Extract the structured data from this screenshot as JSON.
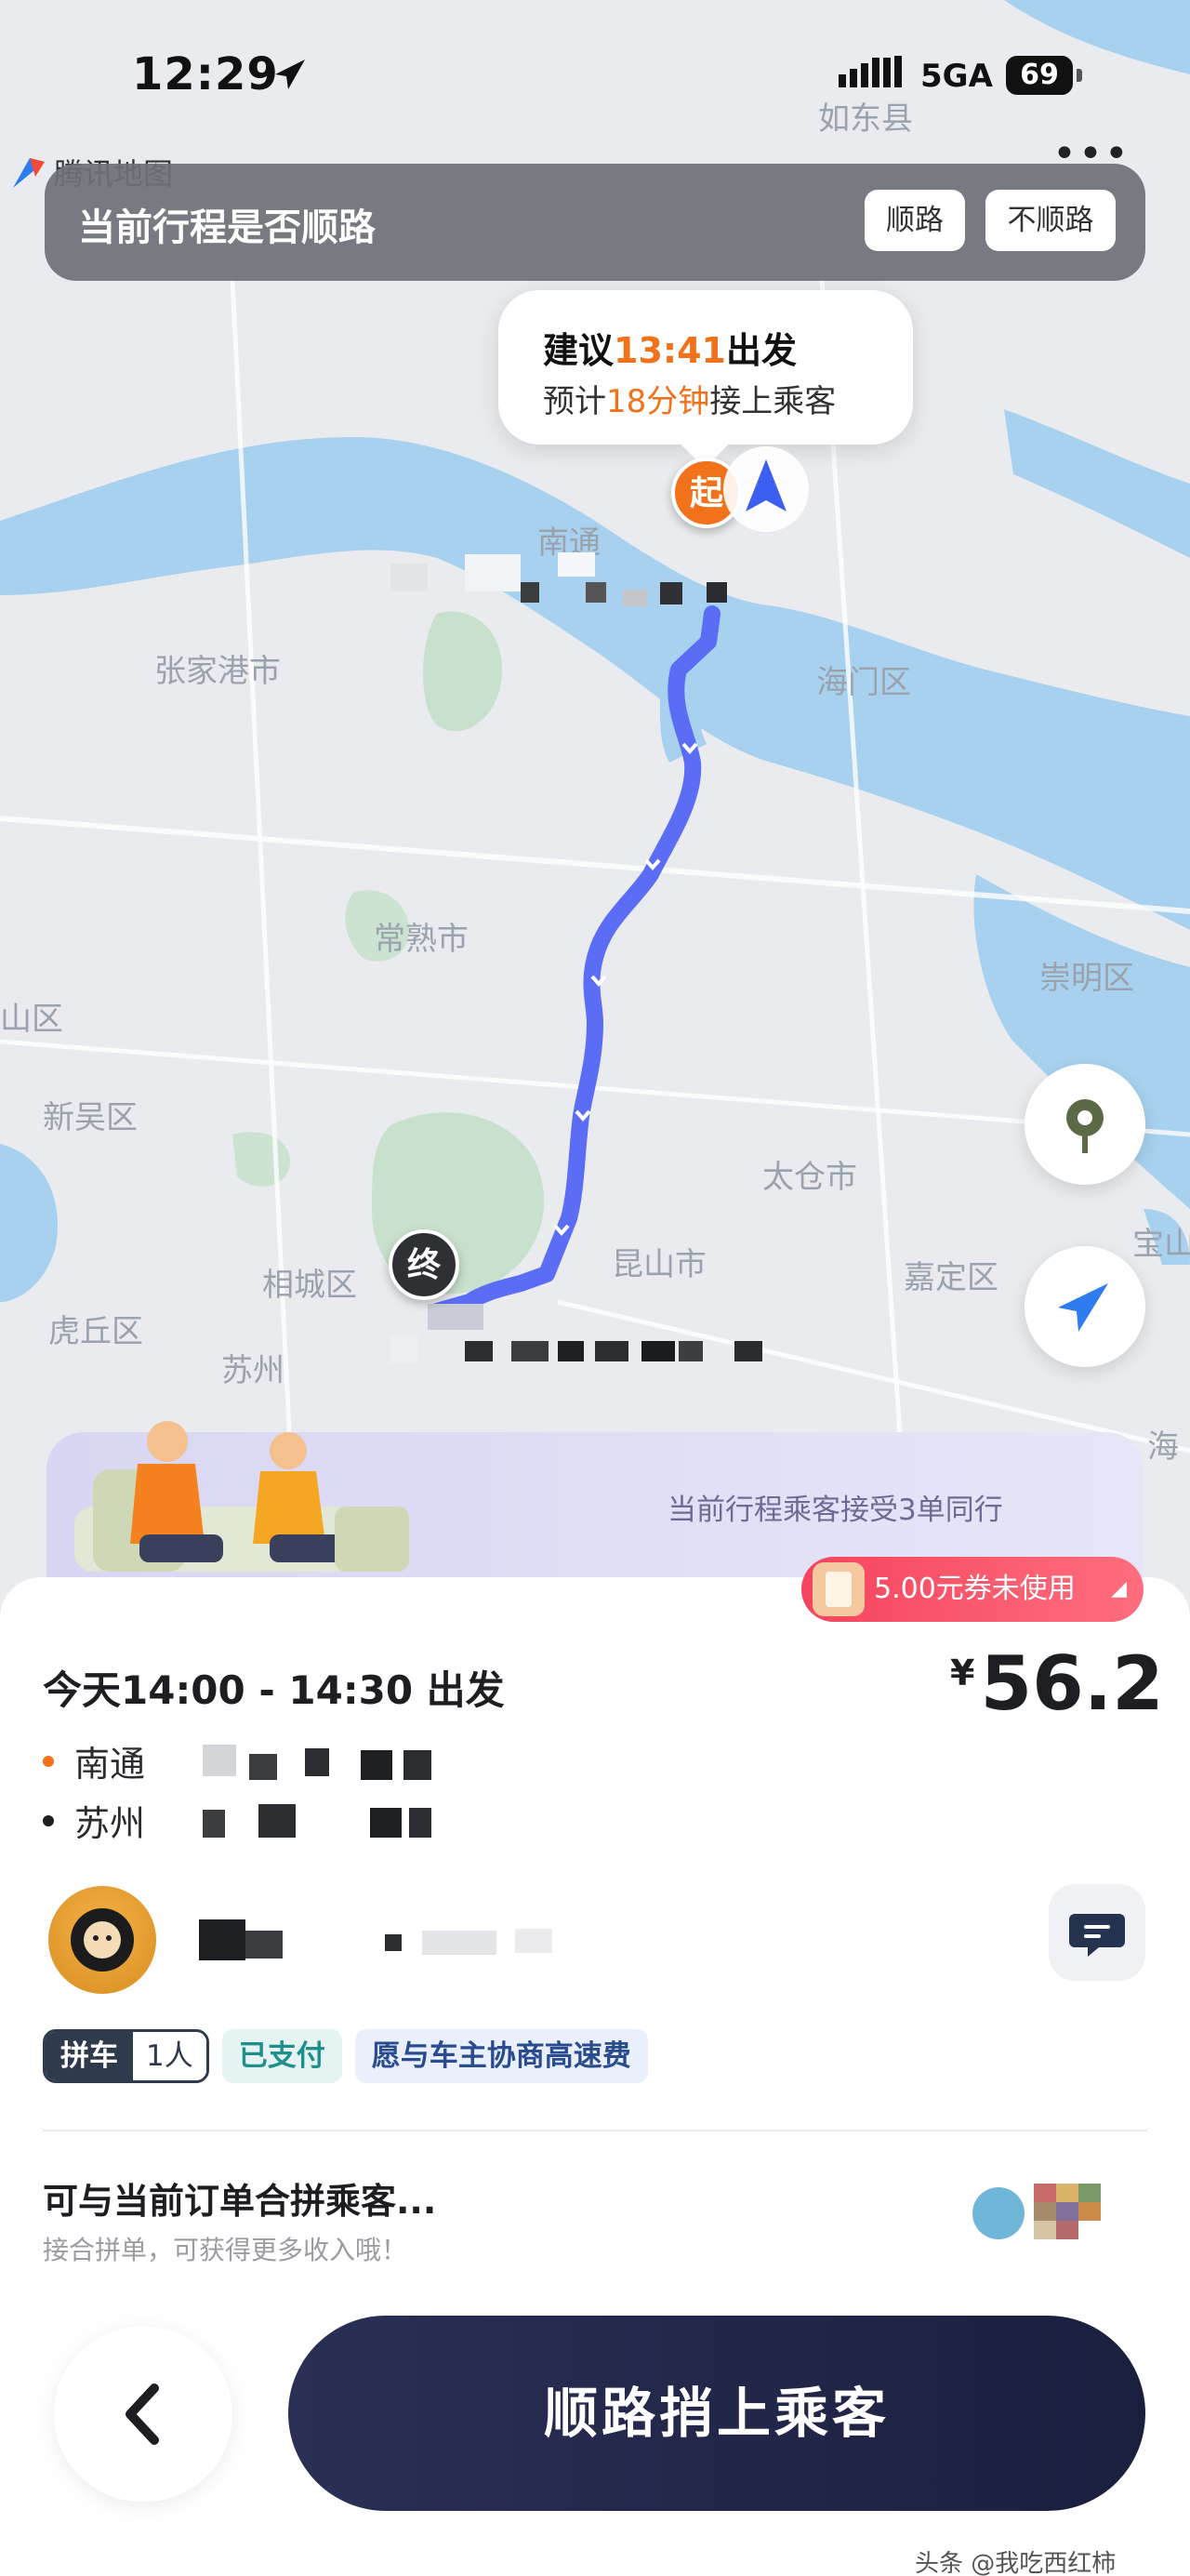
{
  "status_bar": {
    "time": "12:29",
    "network": "5GA",
    "battery": "69"
  },
  "map": {
    "logo_label": "腾讯地图",
    "places": {
      "rudong": "如东县",
      "nantong": "南通",
      "zhangjiagang": "张家港市",
      "haimen": "海门区",
      "changshu": "常熟市",
      "chongming": "崇明区",
      "shan": "山区",
      "xinwu": "新吴区",
      "taicang": "太仓市",
      "xiangcheng": "相城区",
      "kunshan": "昆山市",
      "jiading": "嘉定区",
      "huqiu": "虎丘区",
      "suzhou": "苏州",
      "bao": "宝山",
      "hai": "海"
    },
    "start_marker": "起",
    "end_marker": "终",
    "route_color": "#5b6cf5"
  },
  "route_question": {
    "text": "当前行程是否顺路",
    "yes_label": "顺路",
    "no_label": "不顺路"
  },
  "depart_card": {
    "prefix": "建议",
    "time": "13:41",
    "suffix": "出发",
    "eta_prefix": "预计",
    "eta": "18分钟",
    "eta_suffix": "接上乘客"
  },
  "promo": {
    "text": "当前行程乘客接受3单同行"
  },
  "coupon": {
    "label": "5.00元券未使用"
  },
  "order": {
    "depart_window": "今天14:00 - 14:30 出发",
    "price_symbol": "¥",
    "price": "56.2",
    "start_city": "南通",
    "end_city": "苏州",
    "tags": {
      "carpool": "拼车",
      "people": "1人",
      "paid": "已支付",
      "toll": "愿与车主协商高速费"
    }
  },
  "combine": {
    "title": "可与当前订单合拼乘客...",
    "subtitle": "接合拼单，可获得更多收入哦！"
  },
  "actions": {
    "cta_label": "顺路捎上乘客"
  },
  "watermark": "头条 @我吃西红柿"
}
